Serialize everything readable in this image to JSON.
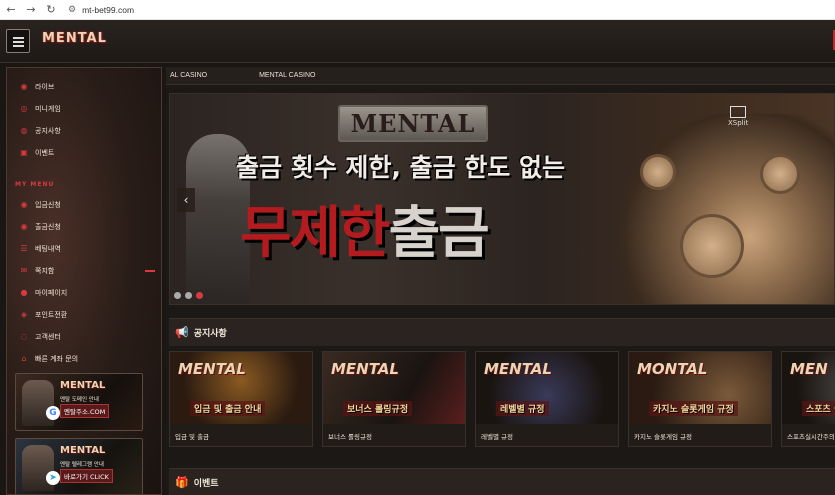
{
  "browser": {
    "url": "mt-bet99.com"
  },
  "header": {
    "logo": "MENTAL"
  },
  "sidebar": {
    "items": [
      {
        "label": "라이브",
        "icon": "live-icon"
      },
      {
        "label": "미니게임",
        "icon": "minigame-icon"
      },
      {
        "label": "공지사항",
        "icon": "notice-icon"
      },
      {
        "label": "이벤트",
        "icon": "gift-icon"
      }
    ],
    "my_menu_heading": "MY MENU",
    "my_menu": [
      {
        "label": "입금신청",
        "icon": "deposit-icon"
      },
      {
        "label": "출금신청",
        "icon": "withdraw-icon"
      },
      {
        "label": "베팅내역",
        "icon": "list-icon"
      },
      {
        "label": "쪽지함",
        "icon": "mail-icon"
      },
      {
        "label": "마이페이지",
        "icon": "user-icon"
      },
      {
        "label": "포인트전환",
        "icon": "point-icon"
      },
      {
        "label": "고객센터",
        "icon": "support-icon"
      },
      {
        "label": "빠른 계좌 문의",
        "icon": "bank-icon"
      }
    ],
    "banners": [
      {
        "title": "MENTAL",
        "subtitle": "멘탈 도메인 안내",
        "url": "멘탈주소.COM"
      },
      {
        "title": "MENTAL",
        "subtitle": "멘탈 텔레그램 안내",
        "url": "바로가기 CLICK"
      }
    ]
  },
  "main": {
    "tabs": [
      "AL CASINO",
      "MENTAL CASINO"
    ],
    "hero": {
      "plate": "MENTAL",
      "line1": "출금 횟수 제한, 출금 한도 없는",
      "line2_red": "무제한",
      "line2_gray": "출금",
      "xsplit": "XSplit",
      "prev": "‹"
    },
    "notice_heading": "공지사항",
    "notice_cards": [
      {
        "art_title": "MENTAL",
        "art_sub": "입금 및 출금 안내",
        "caption": "입금 및 출금"
      },
      {
        "art_title": "MENTAL",
        "art_sub": "보너스 롤링규정",
        "caption": "보너스 롤링규정"
      },
      {
        "art_title": "MENTAL",
        "art_sub": "레벨별 규정",
        "caption": "레벨별 규정"
      },
      {
        "art_title": "MONTAL",
        "art_sub": "카지노 슬롯게임 규정",
        "caption": "카지노 슬롯게임 규정"
      },
      {
        "art_title": "MEN",
        "art_sub": "스포츠 실시간",
        "caption": "스포츠실시간주의"
      }
    ],
    "event_heading": "이벤트"
  },
  "colors": {
    "accent": "#d9393f",
    "background": "#1a1614"
  }
}
